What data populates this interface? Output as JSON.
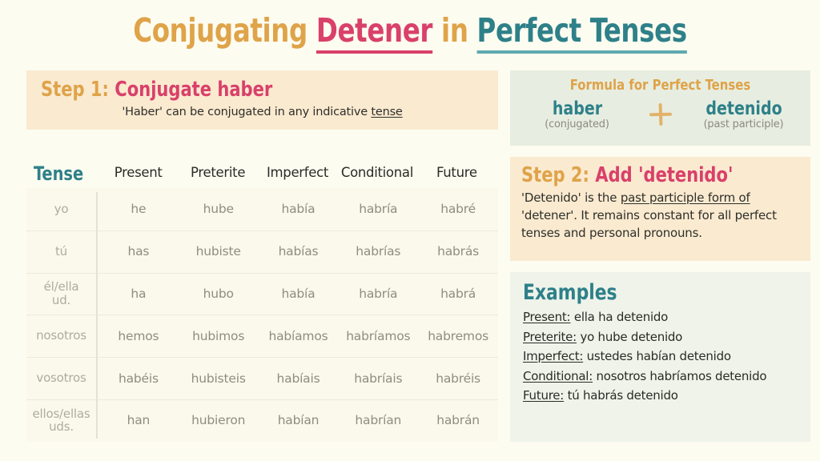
{
  "title": {
    "part1": "Conjugating",
    "verb": "Detener",
    "part2": "in",
    "part3": "Perfect Tenses"
  },
  "step1": {
    "label": "Step 1:",
    "heading": "Conjugate haber",
    "sub_before": "'Haber' can be conjugated in any indicative ",
    "sub_underline": "tense"
  },
  "table": {
    "corner_label": "Tense",
    "columns": [
      "Present",
      "Preterite",
      "Imperfect",
      "Conditional",
      "Future"
    ],
    "rows": [
      {
        "pronoun": "yo",
        "pronoun2": "",
        "values": [
          "he",
          "hube",
          "había",
          "habría",
          "habré"
        ]
      },
      {
        "pronoun": "tú",
        "pronoun2": "",
        "values": [
          "has",
          "hubiste",
          "habías",
          "habrías",
          "habrás"
        ]
      },
      {
        "pronoun": "él/ella",
        "pronoun2": "ud.",
        "values": [
          "ha",
          "hubo",
          "había",
          "habría",
          "habrá"
        ]
      },
      {
        "pronoun": "nosotros",
        "pronoun2": "",
        "values": [
          "hemos",
          "hubimos",
          "habíamos",
          "habríamos",
          "habremos"
        ]
      },
      {
        "pronoun": "vosotros",
        "pronoun2": "",
        "values": [
          "habéis",
          "hubisteis",
          "habíais",
          "habríais",
          "habréis"
        ]
      },
      {
        "pronoun": "ellos/ellas",
        "pronoun2": "uds.",
        "values": [
          "han",
          "hubieron",
          "habían",
          "habrían",
          "habrán"
        ]
      }
    ]
  },
  "formula": {
    "title": "Formula for Perfect Tenses",
    "left_word": "haber",
    "left_note": "(conjugated)",
    "operator": "plus-icon",
    "right_word": "detenido",
    "right_note": "(past participle)"
  },
  "step2": {
    "label": "Step 2:",
    "heading": "Add 'detenido'",
    "body_before": "'Detenido' is the ",
    "body_underline": "past participle form of",
    "body_after": " 'detener'.  It remains constant for all perfect tenses and personal pronouns."
  },
  "examples": {
    "heading": "Examples",
    "items": [
      {
        "label": "Present:",
        "text": " ella ha detenido"
      },
      {
        "label": "Preterite:",
        "text": " yo hube detenido"
      },
      {
        "label": "Imperfect:",
        "text": " ustedes habían detenido"
      },
      {
        "label": "Conditional:",
        "text": " nosotros habríamos detenido"
      },
      {
        "label": "Future:",
        "text": " tú habrás detenido"
      }
    ]
  },
  "colors": {
    "orange": "#dfa349",
    "pink": "#d9406a",
    "teal": "#2e8089",
    "peach_panel": "#faead0",
    "mint_panel": "#e7eee1",
    "palemint_panel": "#eff3ea",
    "page_background": "#fdfcf0"
  }
}
